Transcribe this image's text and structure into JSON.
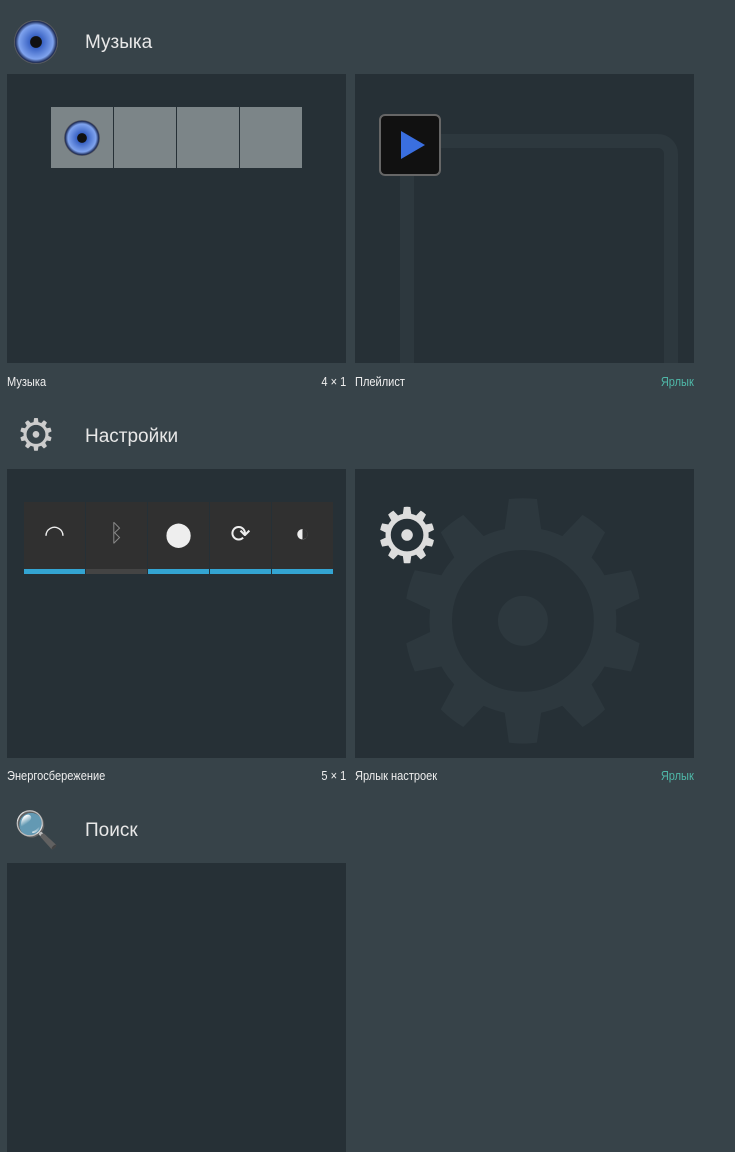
{
  "sections": [
    {
      "title": "Музыка",
      "icon": "speaker-icon",
      "widgets": [
        {
          "name": "Музыка",
          "size": "4 × 1"
        },
        {
          "name": "Плейлист",
          "type": "Ярлык"
        }
      ]
    },
    {
      "title": "Настройки",
      "icon": "gear-icon",
      "widgets": [
        {
          "name": "Энергосбережение",
          "size": "5 × 1"
        },
        {
          "name": "Ярлык настроек",
          "type": "Ярлык"
        }
      ]
    },
    {
      "title": "Поиск",
      "icon": "magnifier-icon"
    }
  ],
  "power_toggles": [
    {
      "icon": "wifi-icon",
      "glyph": "◠",
      "on": true
    },
    {
      "icon": "bluetooth-icon",
      "glyph": "ᛒ",
      "on": false
    },
    {
      "icon": "location-icon",
      "glyph": "⬤",
      "on": true
    },
    {
      "icon": "sync-icon",
      "glyph": "⟳",
      "on": true
    },
    {
      "icon": "brightness-icon",
      "glyph": "◐",
      "on": true
    }
  ],
  "colors": {
    "accent": "#33a4d2",
    "shortcut": "#4fb8a8"
  }
}
